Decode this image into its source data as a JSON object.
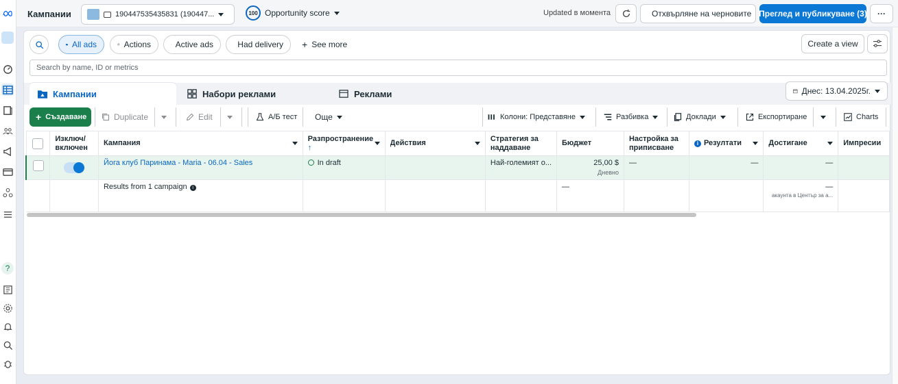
{
  "header": {
    "title": "Кампании",
    "account": "190447535435831 (190447...",
    "opportunity_score": "100",
    "opportunity_label": "Opportunity score",
    "updated": "Updated в момента",
    "discard_label": "Отхвърляне на черновите",
    "publish_label": "Преглед и публикуване (3)",
    "more_label": "···"
  },
  "filters": {
    "all_ads": "All ads",
    "actions": "Actions",
    "active_ads": "Active ads",
    "had_delivery": "Had delivery",
    "see_more": "See more",
    "create_view": "Create a view",
    "search_placeholder": "Search by name, ID or metrics"
  },
  "tabs": {
    "campaigns": "Кампании",
    "adsets": "Набори реклами",
    "ads": "Реклами",
    "date": "Днес: 13.04.2025г."
  },
  "toolbar": {
    "create": "Създаване",
    "duplicate": "Duplicate",
    "edit": "Edit",
    "ab_test": "А/Б тест",
    "more": "Още",
    "columns": "Колони: Представяне",
    "breakdown": "Разбивка",
    "reports": "Доклади",
    "export": "Експортиране",
    "charts": "Charts"
  },
  "table": {
    "headers": {
      "toggle": "Изключ/ включен",
      "campaign": "Кампания",
      "delivery": "Разпространение",
      "actions": "Действия",
      "bid_strategy": "Стратегия за наддаване",
      "budget": "Бюджет",
      "attribution": "Настройка за приписване",
      "results": "Резултати",
      "reach": "Достигане",
      "impressions": "Импресии"
    },
    "row": {
      "campaign": "Йога клуб Паринама - Maria - 06.04 - Sales",
      "delivery": "In draft",
      "bid_strategy": "Най-големият о...",
      "budget": "25,00 $",
      "budget_period": "Дневно",
      "attribution": "—",
      "results": "—",
      "reach": "—"
    },
    "total": {
      "label": "Results from 1 campaign",
      "attribution": "—",
      "reach": "—",
      "reach_note": "акаунта в Център за а..."
    }
  },
  "colors": {
    "accent": "#0a78d4",
    "create": "#1b7f4c",
    "selected_row": "#e8f5ee"
  }
}
